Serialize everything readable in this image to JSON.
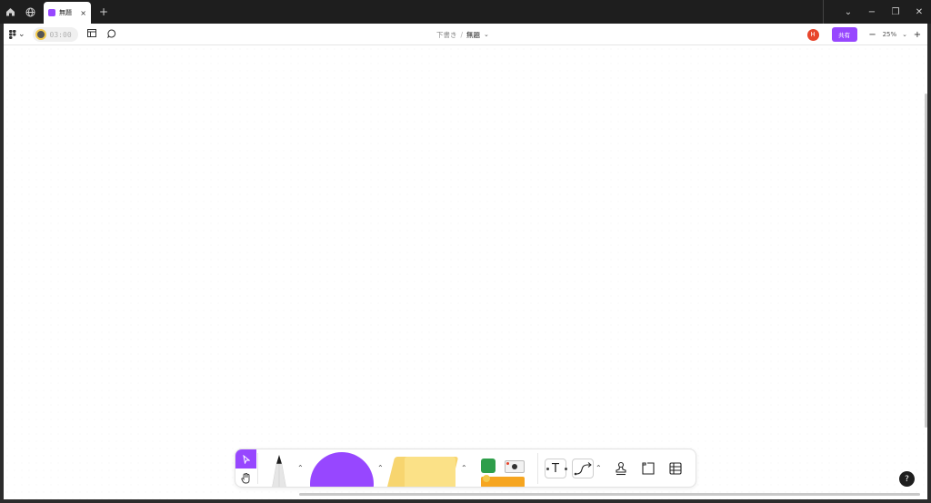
{
  "tabbar": {
    "home_icon": "home-icon",
    "globe_icon": "globe-icon",
    "tab": {
      "label": "無題",
      "close": "×"
    },
    "add_tab": "+",
    "controls": {
      "dropdown": "⌄",
      "minimize": "−",
      "restore": "❐",
      "close": "✕"
    }
  },
  "toolbar": {
    "main_menu_chevron": "⌄",
    "timer": "03:00",
    "breadcrumb": {
      "draft": "下書き",
      "separator": "/",
      "file": "無題",
      "chevron": "⌄"
    },
    "avatar_initial": "H",
    "share_label": "共有",
    "zoom": {
      "minus": "−",
      "value": "25%",
      "chevron": "⌄",
      "plus": "+"
    }
  },
  "canvas": {
    "help_label": "?"
  },
  "dock": {
    "select_icon": "cursor-icon",
    "hand_icon": "hand-icon",
    "text_tool_label": "T",
    "chevron": "⌃"
  },
  "colors": {
    "accent": "#9747ff",
    "avatar": "#e8452c",
    "sticky": "#fbe187"
  }
}
